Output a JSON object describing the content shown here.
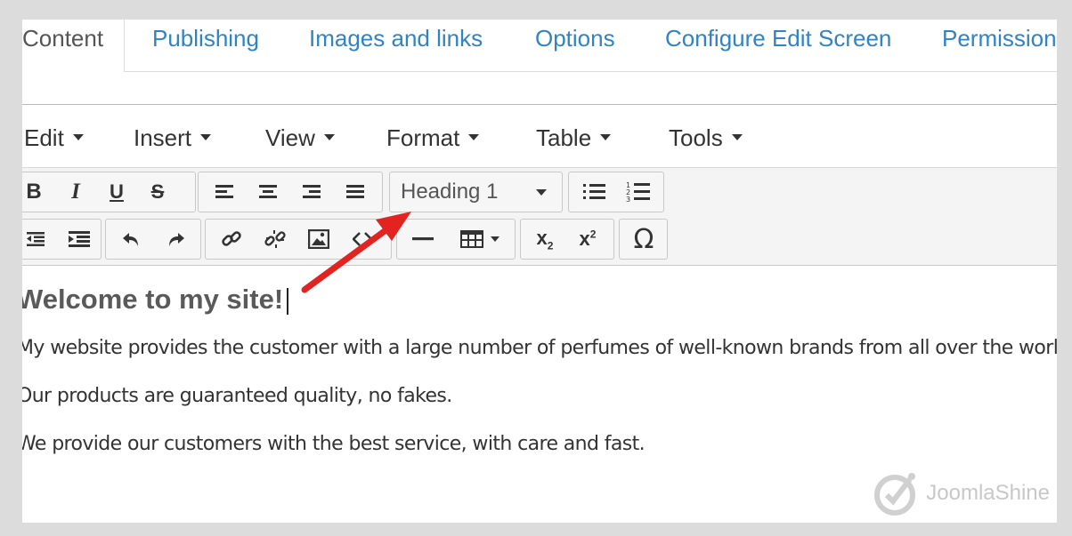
{
  "tabs": [
    {
      "label": "Content",
      "active": true
    },
    {
      "label": "Publishing",
      "active": false
    },
    {
      "label": "Images and links",
      "active": false
    },
    {
      "label": "Options",
      "active": false
    },
    {
      "label": "Configure Edit Screen",
      "active": false
    },
    {
      "label": "Permissions",
      "active": false
    }
  ],
  "menubar": {
    "items": [
      "Edit",
      "Insert",
      "View",
      "Format",
      "Table",
      "Tools"
    ]
  },
  "toolbar": {
    "format_select": "Heading 1",
    "icons_row1": [
      "bold-icon",
      "italic-icon",
      "underline-icon",
      "strikethrough-icon",
      "align-left-icon",
      "align-center-icon",
      "align-right-icon",
      "align-justify-icon",
      "bullet-list-icon",
      "numbered-list-icon"
    ],
    "icons_row2": [
      "outdent-icon",
      "indent-icon",
      "undo-icon",
      "redo-icon",
      "link-icon",
      "unlink-icon",
      "image-icon",
      "horizontal-rule-icon",
      "table-icon",
      "subscript-icon",
      "superscript-icon",
      "special-character-icon"
    ]
  },
  "editor": {
    "heading": "Welcome to my site!",
    "paragraphs": [
      "My website provides the customer with a large number of perfumes of well-known brands from all over the world.",
      "Our products are guaranteed quality, no fakes.",
      "We provide our customers with the best service, with care and fast."
    ]
  },
  "watermark": "JoomlaShine",
  "colors": {
    "tab_link": "#3083c6",
    "annotation_arrow": "#e3231f"
  }
}
